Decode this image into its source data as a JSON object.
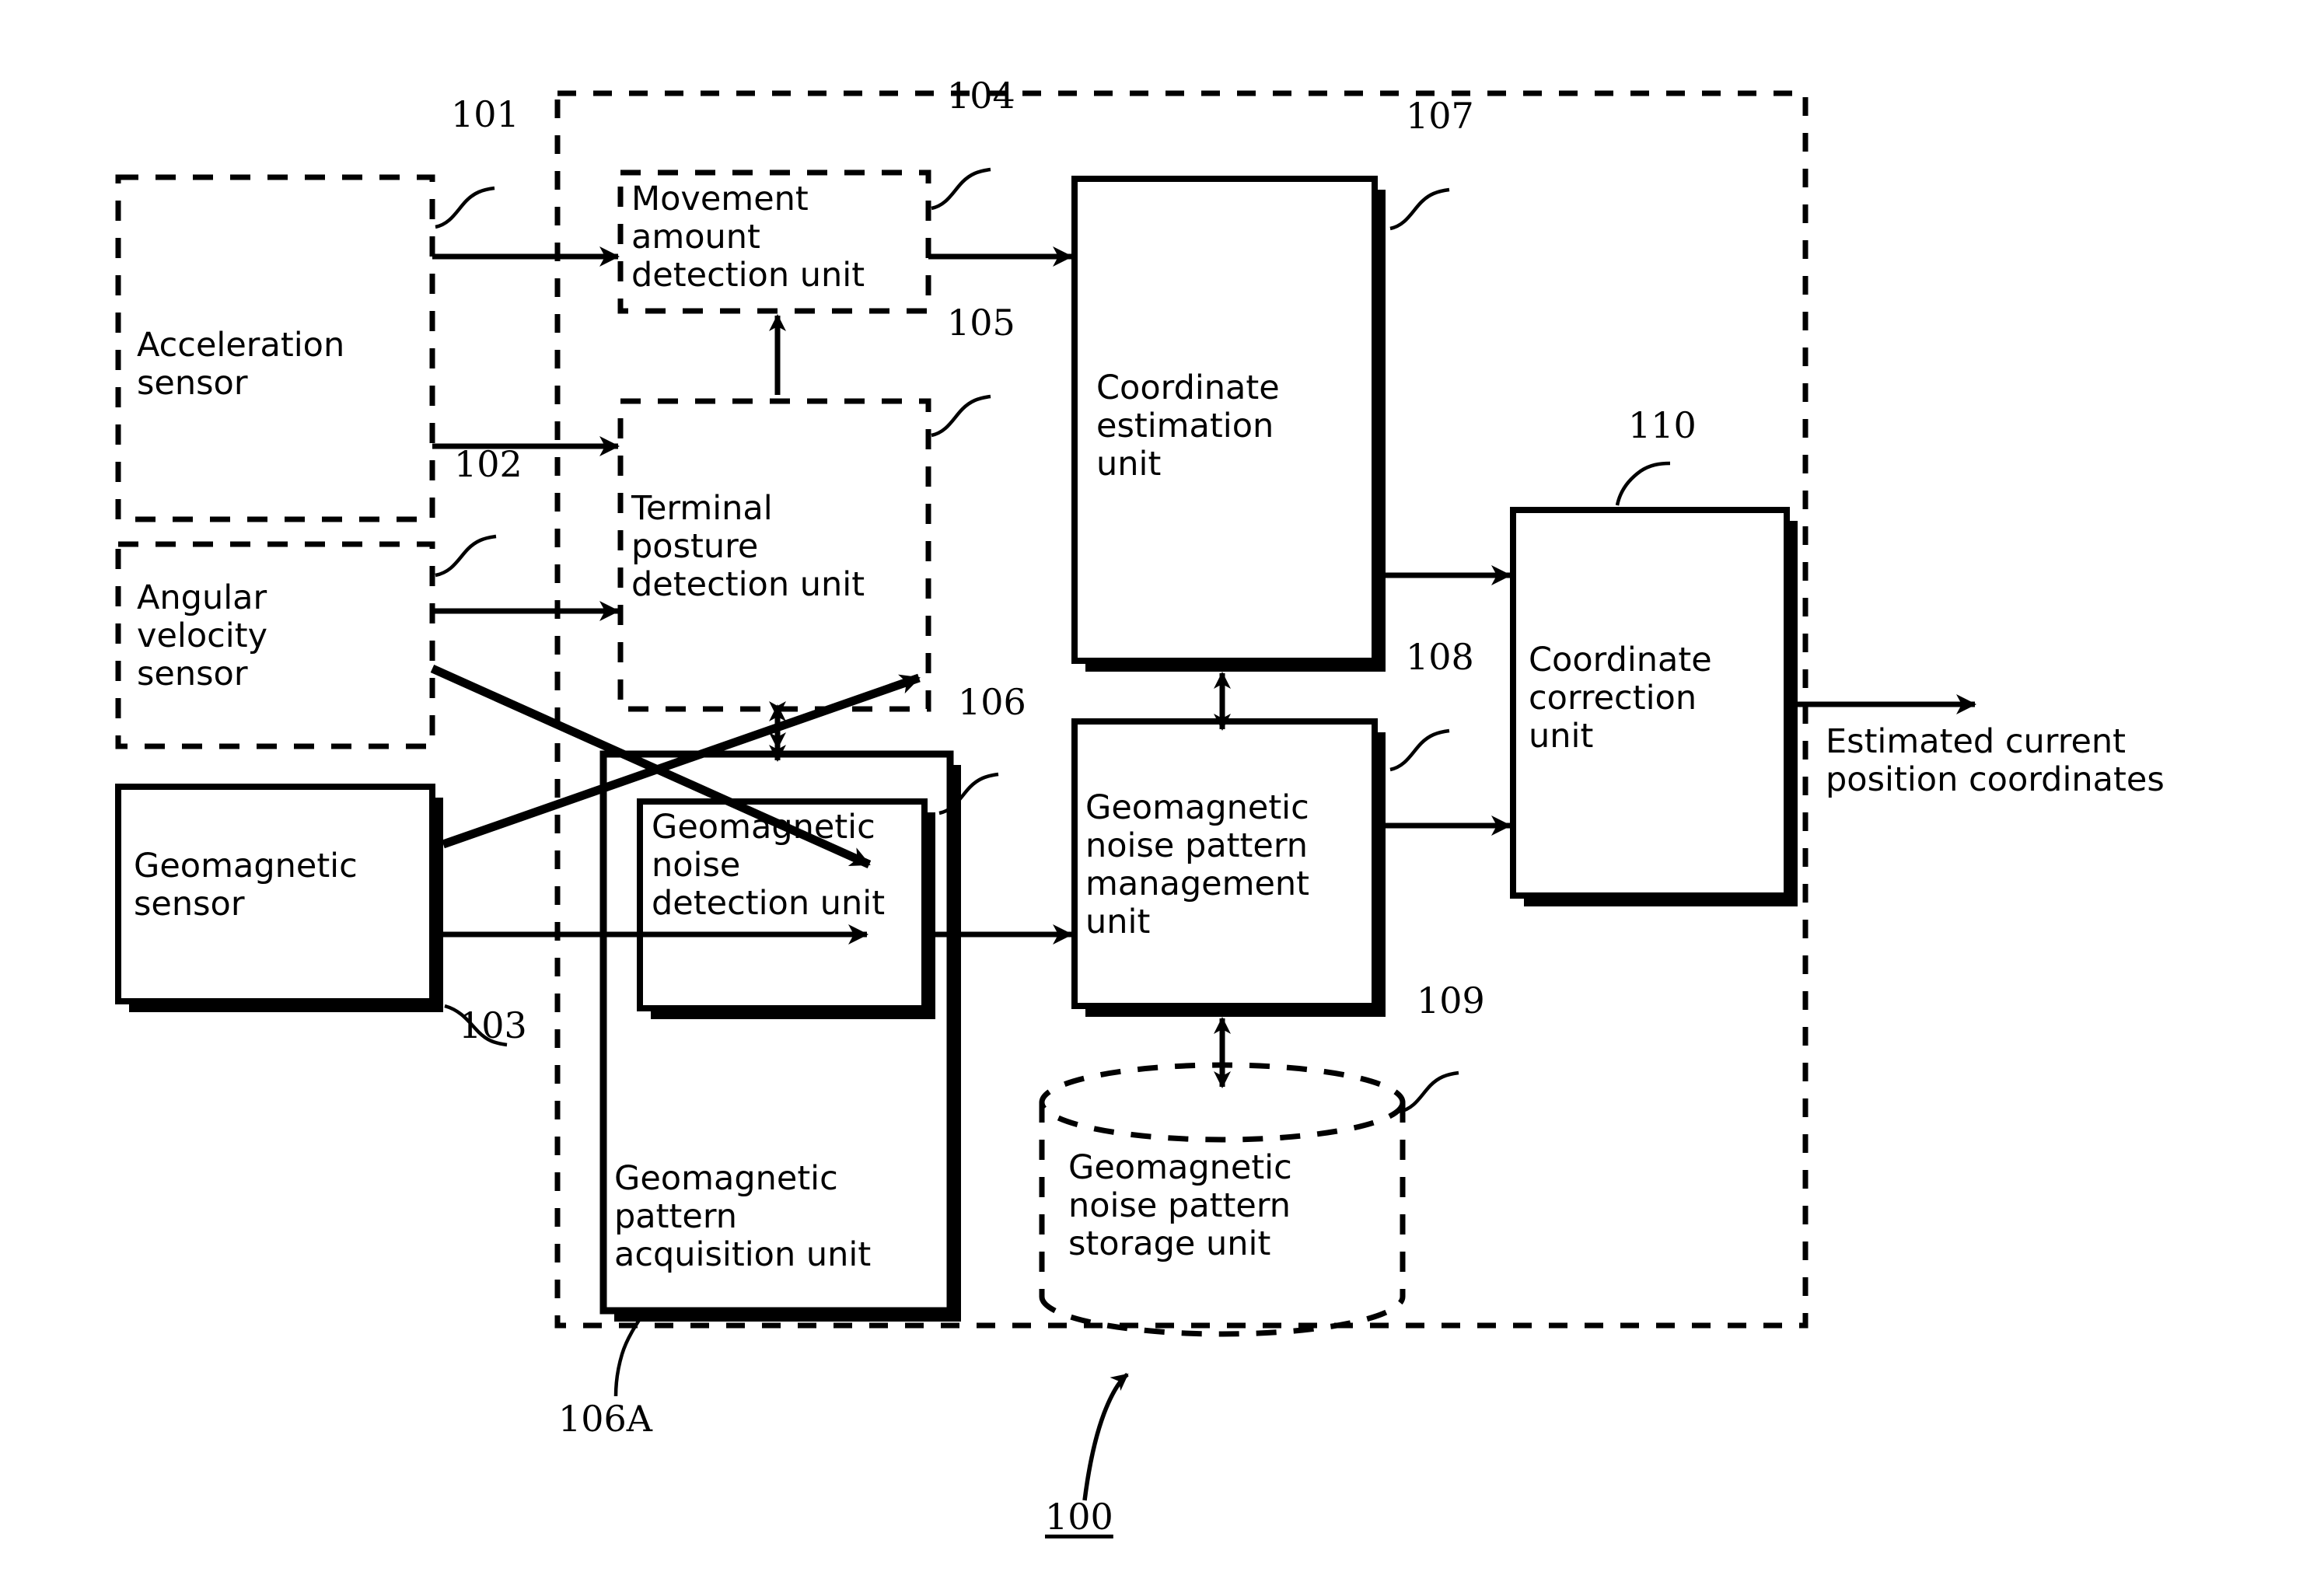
{
  "figure": {
    "type": "patent-block-diagram",
    "system_reference": "100",
    "output_label": "Estimated current\nposition coordinates"
  },
  "blocks": [
    {
      "id": "acceleration-sensor",
      "ref": "101",
      "label": "Acceleration\nsensor",
      "style": "dashed"
    },
    {
      "id": "angular-velocity-sensor",
      "ref": "102",
      "label": "Angular\nvelocity\nsensor",
      "style": "dashed"
    },
    {
      "id": "geomagnetic-sensor",
      "ref": "103",
      "label": "Geomagnetic\nsensor",
      "style": "solid-shadow"
    },
    {
      "id": "movement-amount-detection-unit",
      "ref": "104",
      "label": "Movement\namount\ndetection unit",
      "style": "dashed"
    },
    {
      "id": "terminal-posture-detection-unit",
      "ref": "105",
      "label": "Terminal\nposture\ndetection unit",
      "style": "dashed"
    },
    {
      "id": "geomagnetic-noise-detection-unit",
      "ref": "106",
      "label": "Geomagnetic\nnoise\ndetection unit",
      "style": "solid-shadow"
    },
    {
      "id": "geomagnetic-pattern-acquisition-unit",
      "ref": "106A",
      "label": "Geomagnetic\npattern\nacquisition unit",
      "style": "solid-shadow"
    },
    {
      "id": "coordinate-estimation-unit",
      "ref": "107",
      "label": "Coordinate\nestimation\nunit",
      "style": "solid-shadow"
    },
    {
      "id": "geomagnetic-noise-pattern-management-unit",
      "ref": "108",
      "label": "Geomagnetic\nnoise pattern\nmanagement\nunit",
      "style": "solid-shadow"
    },
    {
      "id": "geomagnetic-noise-pattern-storage-unit",
      "ref": "109",
      "label": "Geomagnetic\nnoise pattern\nstorage unit",
      "style": "dashed-cylinder"
    },
    {
      "id": "coordinate-correction-unit",
      "ref": "110",
      "label": "Coordinate\ncorrection\nunit",
      "style": "solid-shadow"
    }
  ],
  "refs": {
    "r101": "101",
    "r102": "102",
    "r103": "103",
    "r104": "104",
    "r105": "105",
    "r106": "106",
    "r106a": "106A",
    "r107": "107",
    "r108": "108",
    "r109": "109",
    "r110": "110",
    "r100": "100"
  },
  "labels": {
    "acceleration_sensor": "Acceleration\nsensor",
    "angular_velocity_sensor": "Angular\nvelocity\nsensor",
    "geomagnetic_sensor": "Geomagnetic\nsensor",
    "movement_amount_detection_unit": "Movement\namount\ndetection unit",
    "terminal_posture_detection_unit": "Terminal\nposture\ndetection unit",
    "geomagnetic_noise_detection_unit": "Geomagnetic\nnoise\ndetection unit",
    "geomagnetic_pattern_acquisition_unit": "Geomagnetic\npattern\nacquisition unit",
    "coordinate_estimation_unit": "Coordinate\nestimation\nunit",
    "geomagnetic_noise_pattern_management_unit": "Geomagnetic\nnoise pattern\nmanagement\nunit",
    "geomagnetic_noise_pattern_storage_unit": "Geomagnetic\nnoise pattern\nstorage unit",
    "coordinate_correction_unit": "Coordinate\ncorrection\nunit",
    "estimated_current_position_coordinates": "Estimated current\nposition coordinates"
  },
  "colors": {
    "ink": "#000000",
    "paper": "#ffffff"
  }
}
